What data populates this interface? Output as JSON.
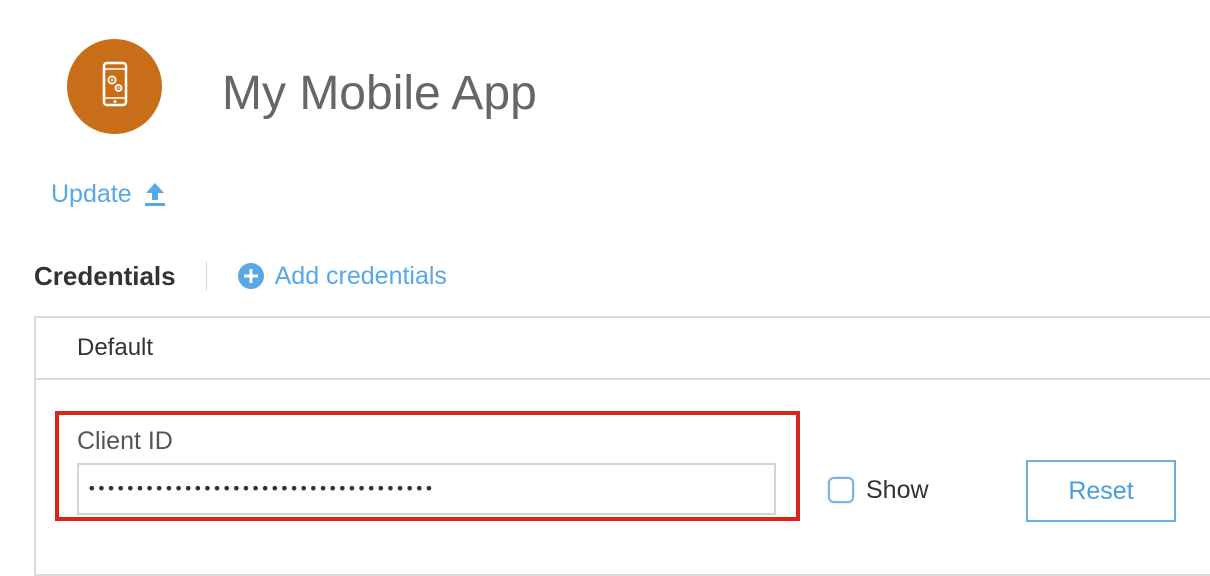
{
  "app": {
    "title": "My Mobile App",
    "icon": "mobile-app-settings-icon",
    "icon_color": "#c96e18"
  },
  "update": {
    "label": "Update",
    "icon": "upload-arrow-icon"
  },
  "credentials": {
    "heading": "Credentials",
    "add_label": "Add credentials",
    "add_icon": "plus-circle-icon"
  },
  "panel": {
    "header": "Default",
    "client_id": {
      "label": "Client ID",
      "value": "••••••••••••••••••••••••••••••••••••"
    },
    "show_label": "Show",
    "show_checked": false,
    "reset_label": "Reset"
  },
  "colors": {
    "link": "#5aa7e6",
    "highlight_border": "#d8261d",
    "button_border": "#6aaee8"
  }
}
